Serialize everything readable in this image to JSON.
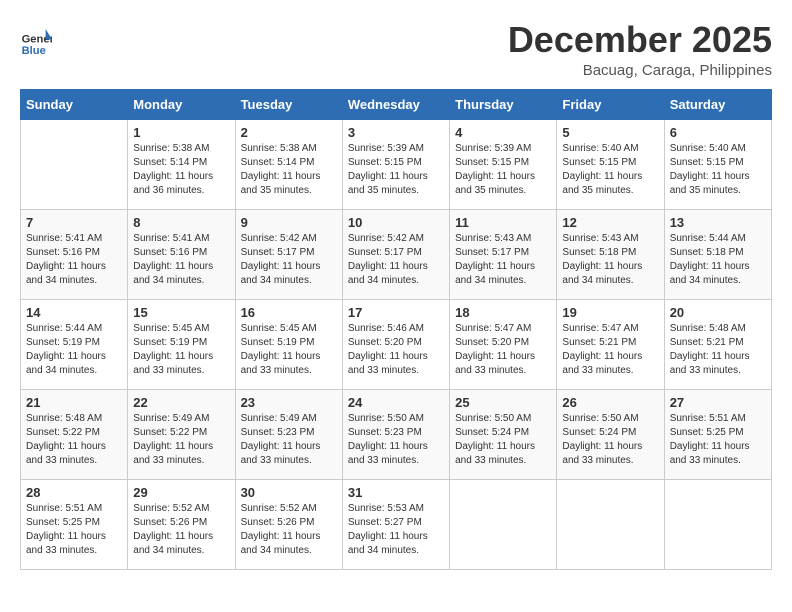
{
  "logo": {
    "line1": "General",
    "line2": "Blue"
  },
  "title": "December 2025",
  "location": "Bacuag, Caraga, Philippines",
  "headers": [
    "Sunday",
    "Monday",
    "Tuesday",
    "Wednesday",
    "Thursday",
    "Friday",
    "Saturday"
  ],
  "weeks": [
    [
      {
        "day": "",
        "info": ""
      },
      {
        "day": "1",
        "info": "Sunrise: 5:38 AM\nSunset: 5:14 PM\nDaylight: 11 hours\nand 36 minutes."
      },
      {
        "day": "2",
        "info": "Sunrise: 5:38 AM\nSunset: 5:14 PM\nDaylight: 11 hours\nand 35 minutes."
      },
      {
        "day": "3",
        "info": "Sunrise: 5:39 AM\nSunset: 5:15 PM\nDaylight: 11 hours\nand 35 minutes."
      },
      {
        "day": "4",
        "info": "Sunrise: 5:39 AM\nSunset: 5:15 PM\nDaylight: 11 hours\nand 35 minutes."
      },
      {
        "day": "5",
        "info": "Sunrise: 5:40 AM\nSunset: 5:15 PM\nDaylight: 11 hours\nand 35 minutes."
      },
      {
        "day": "6",
        "info": "Sunrise: 5:40 AM\nSunset: 5:15 PM\nDaylight: 11 hours\nand 35 minutes."
      }
    ],
    [
      {
        "day": "7",
        "info": "Sunrise: 5:41 AM\nSunset: 5:16 PM\nDaylight: 11 hours\nand 34 minutes."
      },
      {
        "day": "8",
        "info": "Sunrise: 5:41 AM\nSunset: 5:16 PM\nDaylight: 11 hours\nand 34 minutes."
      },
      {
        "day": "9",
        "info": "Sunrise: 5:42 AM\nSunset: 5:17 PM\nDaylight: 11 hours\nand 34 minutes."
      },
      {
        "day": "10",
        "info": "Sunrise: 5:42 AM\nSunset: 5:17 PM\nDaylight: 11 hours\nand 34 minutes."
      },
      {
        "day": "11",
        "info": "Sunrise: 5:43 AM\nSunset: 5:17 PM\nDaylight: 11 hours\nand 34 minutes."
      },
      {
        "day": "12",
        "info": "Sunrise: 5:43 AM\nSunset: 5:18 PM\nDaylight: 11 hours\nand 34 minutes."
      },
      {
        "day": "13",
        "info": "Sunrise: 5:44 AM\nSunset: 5:18 PM\nDaylight: 11 hours\nand 34 minutes."
      }
    ],
    [
      {
        "day": "14",
        "info": "Sunrise: 5:44 AM\nSunset: 5:19 PM\nDaylight: 11 hours\nand 34 minutes."
      },
      {
        "day": "15",
        "info": "Sunrise: 5:45 AM\nSunset: 5:19 PM\nDaylight: 11 hours\nand 33 minutes."
      },
      {
        "day": "16",
        "info": "Sunrise: 5:45 AM\nSunset: 5:19 PM\nDaylight: 11 hours\nand 33 minutes."
      },
      {
        "day": "17",
        "info": "Sunrise: 5:46 AM\nSunset: 5:20 PM\nDaylight: 11 hours\nand 33 minutes."
      },
      {
        "day": "18",
        "info": "Sunrise: 5:47 AM\nSunset: 5:20 PM\nDaylight: 11 hours\nand 33 minutes."
      },
      {
        "day": "19",
        "info": "Sunrise: 5:47 AM\nSunset: 5:21 PM\nDaylight: 11 hours\nand 33 minutes."
      },
      {
        "day": "20",
        "info": "Sunrise: 5:48 AM\nSunset: 5:21 PM\nDaylight: 11 hours\nand 33 minutes."
      }
    ],
    [
      {
        "day": "21",
        "info": "Sunrise: 5:48 AM\nSunset: 5:22 PM\nDaylight: 11 hours\nand 33 minutes."
      },
      {
        "day": "22",
        "info": "Sunrise: 5:49 AM\nSunset: 5:22 PM\nDaylight: 11 hours\nand 33 minutes."
      },
      {
        "day": "23",
        "info": "Sunrise: 5:49 AM\nSunset: 5:23 PM\nDaylight: 11 hours\nand 33 minutes."
      },
      {
        "day": "24",
        "info": "Sunrise: 5:50 AM\nSunset: 5:23 PM\nDaylight: 11 hours\nand 33 minutes."
      },
      {
        "day": "25",
        "info": "Sunrise: 5:50 AM\nSunset: 5:24 PM\nDaylight: 11 hours\nand 33 minutes."
      },
      {
        "day": "26",
        "info": "Sunrise: 5:50 AM\nSunset: 5:24 PM\nDaylight: 11 hours\nand 33 minutes."
      },
      {
        "day": "27",
        "info": "Sunrise: 5:51 AM\nSunset: 5:25 PM\nDaylight: 11 hours\nand 33 minutes."
      }
    ],
    [
      {
        "day": "28",
        "info": "Sunrise: 5:51 AM\nSunset: 5:25 PM\nDaylight: 11 hours\nand 33 minutes."
      },
      {
        "day": "29",
        "info": "Sunrise: 5:52 AM\nSunset: 5:26 PM\nDaylight: 11 hours\nand 34 minutes."
      },
      {
        "day": "30",
        "info": "Sunrise: 5:52 AM\nSunset: 5:26 PM\nDaylight: 11 hours\nand 34 minutes."
      },
      {
        "day": "31",
        "info": "Sunrise: 5:53 AM\nSunset: 5:27 PM\nDaylight: 11 hours\nand 34 minutes."
      },
      {
        "day": "",
        "info": ""
      },
      {
        "day": "",
        "info": ""
      },
      {
        "day": "",
        "info": ""
      }
    ]
  ]
}
